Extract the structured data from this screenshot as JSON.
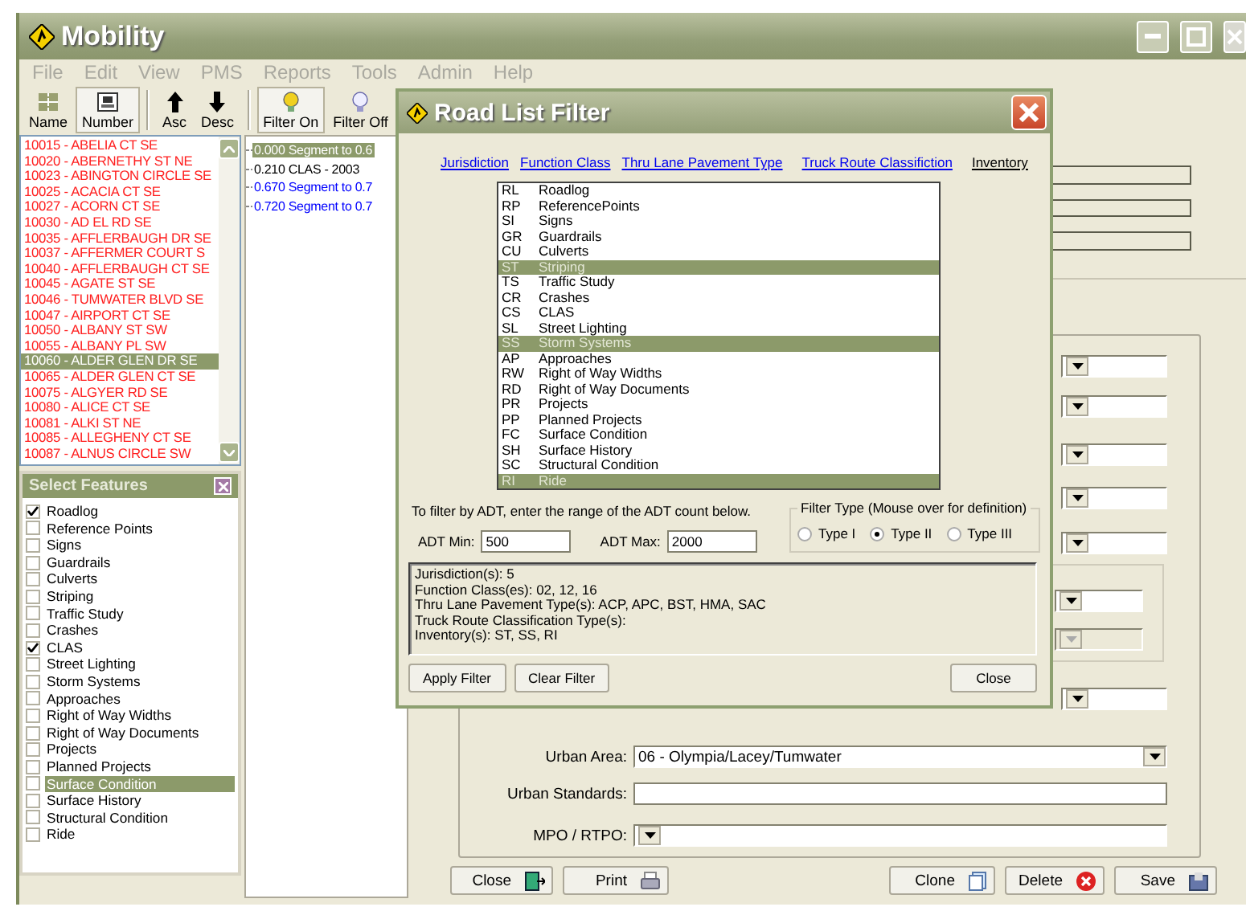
{
  "window": {
    "title": "Mobility"
  },
  "menu": [
    {
      "label": "File",
      "disabled": true
    },
    {
      "label": "Edit",
      "disabled": true
    },
    {
      "label": "View",
      "disabled": true
    },
    {
      "label": "PMS",
      "disabled": true
    },
    {
      "label": "Reports",
      "disabled": true
    },
    {
      "label": "Tools",
      "disabled": true
    },
    {
      "label": "Admin",
      "disabled": true
    },
    {
      "label": "Help",
      "disabled": true
    }
  ],
  "toolbar": [
    {
      "label": "Name",
      "kind": "name",
      "pressed": false
    },
    {
      "label": "Number",
      "kind": "number",
      "pressed": true
    },
    {
      "label": "Asc",
      "kind": "asc",
      "pressed": false
    },
    {
      "label": "Desc",
      "kind": "desc",
      "pressed": false
    },
    {
      "label": "Filter On",
      "kind": "filter-on",
      "pressed": true
    },
    {
      "label": "Filter Off",
      "kind": "filter-off",
      "pressed": false
    }
  ],
  "roads": [
    {
      "label": "10015 - ABELIA CT SE",
      "selected": false
    },
    {
      "label": "10020 - ABERNETHY ST NE",
      "selected": false
    },
    {
      "label": "10023 - ABINGTON CIRCLE SE",
      "selected": false
    },
    {
      "label": "10025 - ACACIA CT SE",
      "selected": false
    },
    {
      "label": "10027 - ACORN CT SE",
      "selected": false
    },
    {
      "label": "10030 - AD EL RD SE",
      "selected": false
    },
    {
      "label": "10035 - AFFLERBAUGH DR SE",
      "selected": false
    },
    {
      "label": "10037 - AFFERMER COURT S",
      "selected": false
    },
    {
      "label": "10040 - AFFLERBAUGH CT SE",
      "selected": false
    },
    {
      "label": "10045 - AGATE ST SE",
      "selected": false
    },
    {
      "label": "10046 - TUMWATER BLVD SE",
      "selected": false
    },
    {
      "label": "10047 - AIRPORT CT SE",
      "selected": false
    },
    {
      "label": "10050 - ALBANY ST SW",
      "selected": false
    },
    {
      "label": "10055 - ALBANY PL SW",
      "selected": false
    },
    {
      "label": "10060 - ALDER GLEN DR SE",
      "selected": true
    },
    {
      "label": "10065 - ALDER GLEN CT SE",
      "selected": false
    },
    {
      "label": "10075 - ALGYER RD SE",
      "selected": false
    },
    {
      "label": "10080 - ALICE CT SE",
      "selected": false
    },
    {
      "label": "10081 - ALKI ST NE",
      "selected": false
    },
    {
      "label": "10085 - ALLEGHENY CT SE",
      "selected": false
    },
    {
      "label": "10087 - ALNUS CIRCLE SW",
      "selected": false
    }
  ],
  "segments": [
    {
      "label": "0.000 Segment to 0.6",
      "selected": true
    },
    {
      "label": "0.210 CLAS - 2003",
      "selected": false,
      "color": "#000000"
    },
    {
      "label": "0.670 Segment to 0.7",
      "selected": false,
      "color": "#0000ff"
    },
    {
      "label": "0.720 Segment to 0.7",
      "selected": false,
      "color": "#0000ff"
    }
  ],
  "features": {
    "title": "Select Features",
    "items": [
      {
        "label": "Roadlog",
        "checked": true,
        "selected": false
      },
      {
        "label": "Reference Points",
        "checked": false,
        "selected": false
      },
      {
        "label": "Signs",
        "checked": false,
        "selected": false
      },
      {
        "label": "Guardrails",
        "checked": false,
        "selected": false
      },
      {
        "label": "Culverts",
        "checked": false,
        "selected": false
      },
      {
        "label": "Striping",
        "checked": false,
        "selected": false
      },
      {
        "label": "Traffic Study",
        "checked": false,
        "selected": false
      },
      {
        "label": "Crashes",
        "checked": false,
        "selected": false
      },
      {
        "label": "CLAS",
        "checked": true,
        "selected": false
      },
      {
        "label": "Street Lighting",
        "checked": false,
        "selected": false
      },
      {
        "label": "Storm Systems",
        "checked": false,
        "selected": false
      },
      {
        "label": "Approaches",
        "checked": false,
        "selected": false
      },
      {
        "label": "Right of Way Widths",
        "checked": false,
        "selected": false
      },
      {
        "label": "Right of Way Documents",
        "checked": false,
        "selected": false
      },
      {
        "label": "Projects",
        "checked": false,
        "selected": false
      },
      {
        "label": "Planned Projects",
        "checked": false,
        "selected": false
      },
      {
        "label": "Surface Condition",
        "checked": false,
        "selected": true
      },
      {
        "label": "Surface History",
        "checked": false,
        "selected": false
      },
      {
        "label": "Structural Condition",
        "checked": false,
        "selected": false
      },
      {
        "label": "Ride",
        "checked": false,
        "selected": false
      }
    ]
  },
  "form": {
    "covered_dropdowns": [
      {
        "disabled": false
      },
      {
        "disabled": false
      },
      {
        "disabled": false
      },
      {
        "disabled": false
      },
      {
        "disabled": false
      }
    ],
    "area_group_dropdowns": [
      {
        "disabled": false
      },
      {
        "disabled": true
      }
    ],
    "lower_dropdown": {
      "disabled": false
    },
    "urban_area": {
      "label": "Urban Area:",
      "value": "06 - Olympia/Lacey/Tumwater"
    },
    "urban_standards": {
      "label": "Urban Standards:"
    },
    "mpo": {
      "label": "MPO / RTPO:"
    }
  },
  "actions": [
    {
      "label": "Close",
      "kind": "exit"
    },
    {
      "label": "Print",
      "kind": "print"
    },
    {
      "label": "Clone",
      "kind": "clone"
    },
    {
      "label": "Delete",
      "kind": "delete"
    },
    {
      "label": "Save",
      "kind": "save"
    }
  ],
  "dialog": {
    "title": "Road List Filter",
    "tabs": [
      {
        "label": "Jurisdiction",
        "selected": false
      },
      {
        "label": "Function Class",
        "selected": false
      },
      {
        "label": "Thru Lane Pavement Type",
        "selected": false
      },
      {
        "label": "Truck Route Classifiction",
        "selected": false
      },
      {
        "label": "Inventory",
        "selected": true
      }
    ],
    "inventory": [
      {
        "code": "RL",
        "name": "Roadlog",
        "selected": false
      },
      {
        "code": "RP",
        "name": "ReferencePoints",
        "selected": false
      },
      {
        "code": "SI",
        "name": "Signs",
        "selected": false
      },
      {
        "code": "GR",
        "name": "Guardrails",
        "selected": false
      },
      {
        "code": "CU",
        "name": "Culverts",
        "selected": false
      },
      {
        "code": "ST",
        "name": "Striping",
        "selected": true
      },
      {
        "code": "TS",
        "name": "Traffic Study",
        "selected": false
      },
      {
        "code": "CR",
        "name": "Crashes",
        "selected": false
      },
      {
        "code": "CS",
        "name": "CLAS",
        "selected": false
      },
      {
        "code": "SL",
        "name": "Street Lighting",
        "selected": false
      },
      {
        "code": "SS",
        "name": "Storm Systems",
        "selected": true
      },
      {
        "code": "AP",
        "name": "Approaches",
        "selected": false
      },
      {
        "code": "RW",
        "name": "Right of Way Widths",
        "selected": false
      },
      {
        "code": "RD",
        "name": "Right of Way Documents",
        "selected": false
      },
      {
        "code": "PR",
        "name": "Projects",
        "selected": false
      },
      {
        "code": "PP",
        "name": "Planned Projects",
        "selected": false
      },
      {
        "code": "FC",
        "name": "Surface Condition",
        "selected": false
      },
      {
        "code": "SH",
        "name": "Surface History",
        "selected": false
      },
      {
        "code": "SC",
        "name": "Structural Condition",
        "selected": false
      },
      {
        "code": "RI",
        "name": "Ride",
        "selected": true
      }
    ],
    "adt_hint": "To filter by ADT, enter the range of the ADT  count below.",
    "adt_min": {
      "label": "ADT Min:",
      "value": "500"
    },
    "adt_max": {
      "label": "ADT Max:",
      "value": "2000"
    },
    "filter_type": {
      "title": "Filter Type (Mouse over for definition)",
      "options": [
        {
          "label": "Type I",
          "selected": false
        },
        {
          "label": "Type II",
          "selected": true
        },
        {
          "label": "Type III",
          "selected": false
        }
      ]
    },
    "summary": [
      "Jurisdiction(s):  5",
      "Function Class(es):  02, 12, 16",
      "Thru Lane Pavement Type(s):  ACP, APC, BST, HMA, SAC",
      "Truck Route Classification Type(s):",
      "Inventory(s):  ST, SS, RI"
    ],
    "buttons": [
      {
        "label": "Apply Filter",
        "kind": "apply"
      },
      {
        "label": "Clear Filter",
        "kind": "clear"
      },
      {
        "label": "Close",
        "kind": "close"
      }
    ]
  }
}
